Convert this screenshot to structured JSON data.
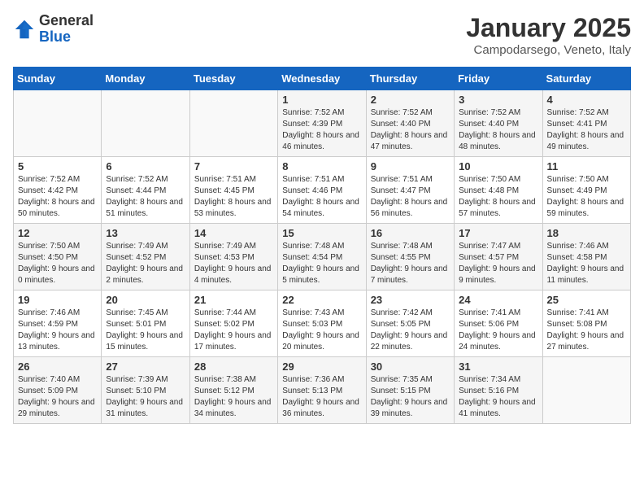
{
  "header": {
    "logo_general": "General",
    "logo_blue": "Blue",
    "title": "January 2025",
    "subtitle": "Campodarsego, Veneto, Italy"
  },
  "days_of_week": [
    "Sunday",
    "Monday",
    "Tuesday",
    "Wednesday",
    "Thursday",
    "Friday",
    "Saturday"
  ],
  "weeks": [
    [
      {
        "day": "",
        "info": ""
      },
      {
        "day": "",
        "info": ""
      },
      {
        "day": "",
        "info": ""
      },
      {
        "day": "1",
        "info": "Sunrise: 7:52 AM\nSunset: 4:39 PM\nDaylight: 8 hours and 46 minutes."
      },
      {
        "day": "2",
        "info": "Sunrise: 7:52 AM\nSunset: 4:40 PM\nDaylight: 8 hours and 47 minutes."
      },
      {
        "day": "3",
        "info": "Sunrise: 7:52 AM\nSunset: 4:40 PM\nDaylight: 8 hours and 48 minutes."
      },
      {
        "day": "4",
        "info": "Sunrise: 7:52 AM\nSunset: 4:41 PM\nDaylight: 8 hours and 49 minutes."
      }
    ],
    [
      {
        "day": "5",
        "info": "Sunrise: 7:52 AM\nSunset: 4:42 PM\nDaylight: 8 hours and 50 minutes."
      },
      {
        "day": "6",
        "info": "Sunrise: 7:52 AM\nSunset: 4:44 PM\nDaylight: 8 hours and 51 minutes."
      },
      {
        "day": "7",
        "info": "Sunrise: 7:51 AM\nSunset: 4:45 PM\nDaylight: 8 hours and 53 minutes."
      },
      {
        "day": "8",
        "info": "Sunrise: 7:51 AM\nSunset: 4:46 PM\nDaylight: 8 hours and 54 minutes."
      },
      {
        "day": "9",
        "info": "Sunrise: 7:51 AM\nSunset: 4:47 PM\nDaylight: 8 hours and 56 minutes."
      },
      {
        "day": "10",
        "info": "Sunrise: 7:50 AM\nSunset: 4:48 PM\nDaylight: 8 hours and 57 minutes."
      },
      {
        "day": "11",
        "info": "Sunrise: 7:50 AM\nSunset: 4:49 PM\nDaylight: 8 hours and 59 minutes."
      }
    ],
    [
      {
        "day": "12",
        "info": "Sunrise: 7:50 AM\nSunset: 4:50 PM\nDaylight: 9 hours and 0 minutes."
      },
      {
        "day": "13",
        "info": "Sunrise: 7:49 AM\nSunset: 4:52 PM\nDaylight: 9 hours and 2 minutes."
      },
      {
        "day": "14",
        "info": "Sunrise: 7:49 AM\nSunset: 4:53 PM\nDaylight: 9 hours and 4 minutes."
      },
      {
        "day": "15",
        "info": "Sunrise: 7:48 AM\nSunset: 4:54 PM\nDaylight: 9 hours and 5 minutes."
      },
      {
        "day": "16",
        "info": "Sunrise: 7:48 AM\nSunset: 4:55 PM\nDaylight: 9 hours and 7 minutes."
      },
      {
        "day": "17",
        "info": "Sunrise: 7:47 AM\nSunset: 4:57 PM\nDaylight: 9 hours and 9 minutes."
      },
      {
        "day": "18",
        "info": "Sunrise: 7:46 AM\nSunset: 4:58 PM\nDaylight: 9 hours and 11 minutes."
      }
    ],
    [
      {
        "day": "19",
        "info": "Sunrise: 7:46 AM\nSunset: 4:59 PM\nDaylight: 9 hours and 13 minutes."
      },
      {
        "day": "20",
        "info": "Sunrise: 7:45 AM\nSunset: 5:01 PM\nDaylight: 9 hours and 15 minutes."
      },
      {
        "day": "21",
        "info": "Sunrise: 7:44 AM\nSunset: 5:02 PM\nDaylight: 9 hours and 17 minutes."
      },
      {
        "day": "22",
        "info": "Sunrise: 7:43 AM\nSunset: 5:03 PM\nDaylight: 9 hours and 20 minutes."
      },
      {
        "day": "23",
        "info": "Sunrise: 7:42 AM\nSunset: 5:05 PM\nDaylight: 9 hours and 22 minutes."
      },
      {
        "day": "24",
        "info": "Sunrise: 7:41 AM\nSunset: 5:06 PM\nDaylight: 9 hours and 24 minutes."
      },
      {
        "day": "25",
        "info": "Sunrise: 7:41 AM\nSunset: 5:08 PM\nDaylight: 9 hours and 27 minutes."
      }
    ],
    [
      {
        "day": "26",
        "info": "Sunrise: 7:40 AM\nSunset: 5:09 PM\nDaylight: 9 hours and 29 minutes."
      },
      {
        "day": "27",
        "info": "Sunrise: 7:39 AM\nSunset: 5:10 PM\nDaylight: 9 hours and 31 minutes."
      },
      {
        "day": "28",
        "info": "Sunrise: 7:38 AM\nSunset: 5:12 PM\nDaylight: 9 hours and 34 minutes."
      },
      {
        "day": "29",
        "info": "Sunrise: 7:36 AM\nSunset: 5:13 PM\nDaylight: 9 hours and 36 minutes."
      },
      {
        "day": "30",
        "info": "Sunrise: 7:35 AM\nSunset: 5:15 PM\nDaylight: 9 hours and 39 minutes."
      },
      {
        "day": "31",
        "info": "Sunrise: 7:34 AM\nSunset: 5:16 PM\nDaylight: 9 hours and 41 minutes."
      },
      {
        "day": "",
        "info": ""
      }
    ]
  ]
}
